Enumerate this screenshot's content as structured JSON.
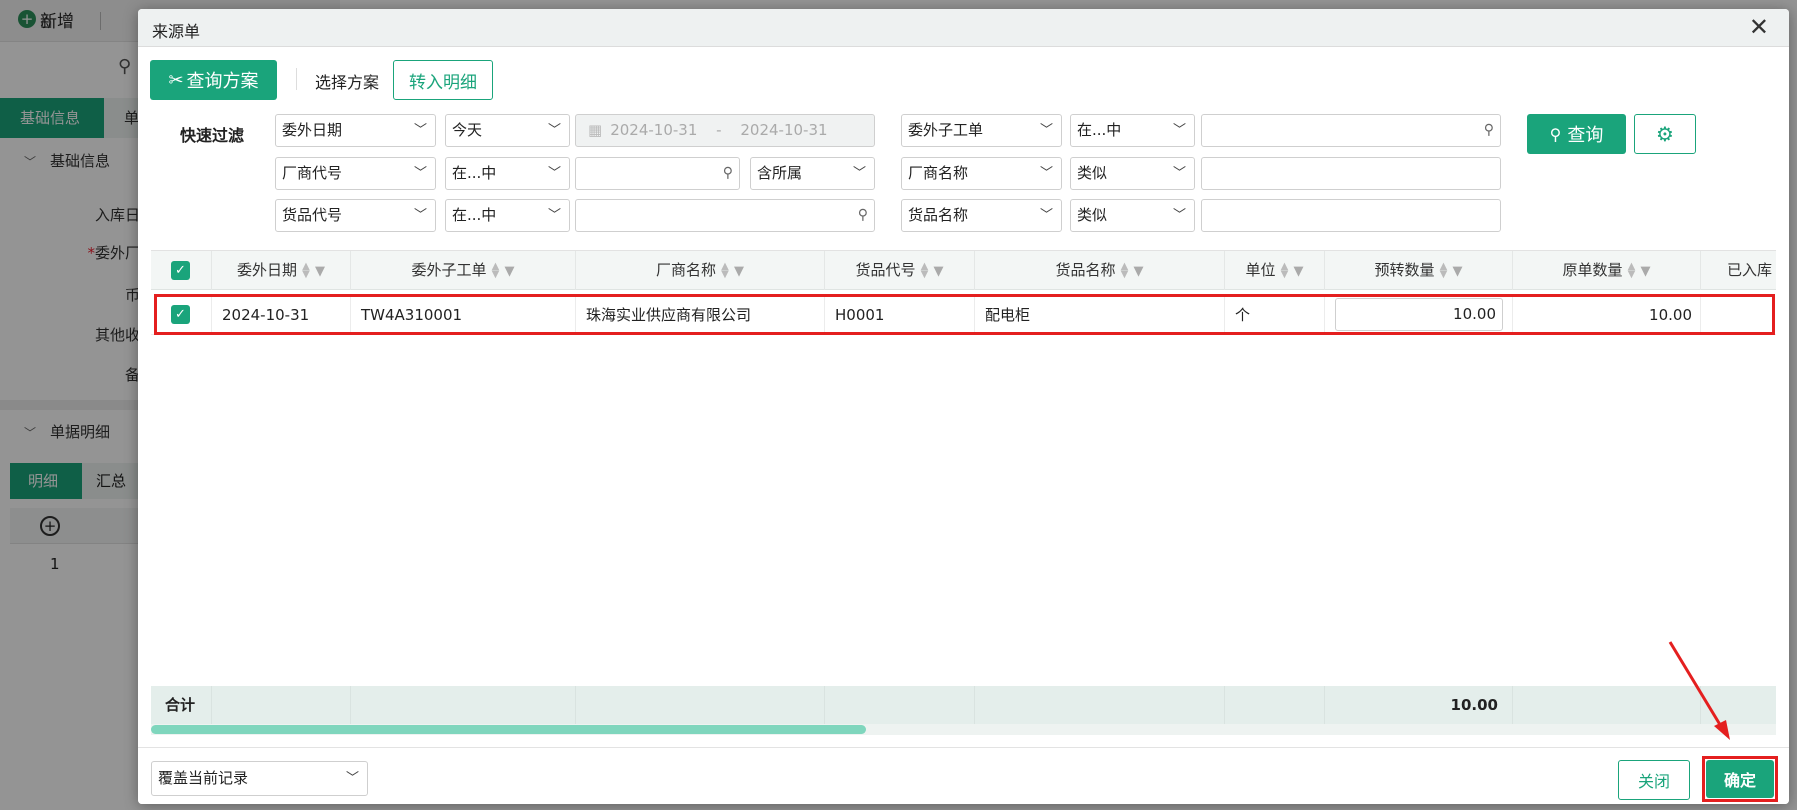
{
  "background": {
    "add_label": "新增",
    "tabs": [
      "基础信息",
      "单"
    ],
    "section1": "基础信息",
    "fields": [
      "入库日",
      "委外厂",
      "币",
      "其他收",
      "备"
    ],
    "section2": "单据明细",
    "detail_tabs": [
      "明细",
      "汇总"
    ],
    "grid_row_index": "1"
  },
  "dialog": {
    "title": "来源单",
    "query_scheme_button": "查询方案",
    "select_scheme_label": "选择方案",
    "transfer_detail_button": "转入明细",
    "quick_filter_label": "快速过滤",
    "query_button": "查询",
    "filters": {
      "row1": {
        "field1": "委外日期",
        "op1": "今天",
        "date_from": "2024-10-31",
        "date_sep": "-",
        "date_to": "2024-10-31",
        "field2": "委外子工单",
        "op2": "在...中",
        "value2": ""
      },
      "row2": {
        "field1": "厂商代号",
        "op1": "在...中",
        "value1": "",
        "scope": "含所属",
        "field2": "厂商名称",
        "op2": "类似",
        "value2": ""
      },
      "row3": {
        "field1": "货品代号",
        "op1": "在...中",
        "value1": "",
        "field2": "货品名称",
        "op2": "类似",
        "value2": ""
      }
    },
    "table": {
      "columns": [
        "委外日期",
        "委外子工单",
        "厂商名称",
        "货品代号",
        "货品名称",
        "单位",
        "预转数量",
        "原单数量",
        "已入库"
      ],
      "rows": [
        {
          "date": "2024-10-31",
          "sub_order": "TW4A310001",
          "vendor": "珠海实业供应商有限公司",
          "item_code": "H0001",
          "item_name": "配电柜",
          "unit": "个",
          "pre_qty": "10.00",
          "orig_qty": "10.00"
        }
      ],
      "footer_label": "合计",
      "footer_total": "10.00"
    },
    "mode_select": "覆盖当前记录",
    "close_button": "关闭",
    "confirm_button": "确定"
  },
  "colors": {
    "accent": "#1aa47b",
    "highlight": "#e41f1f"
  }
}
